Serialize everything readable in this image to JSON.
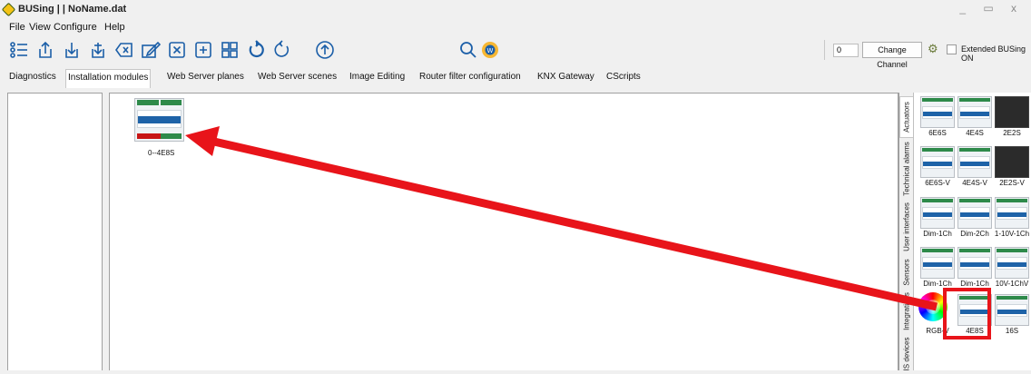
{
  "window": {
    "title": "BUSing | | NoName.dat",
    "controls": "_ ▭ x"
  },
  "menu": [
    "File",
    "View",
    "Configure",
    "Help"
  ],
  "toolbar": {
    "icons": [
      "list-icon",
      "upload-icon",
      "download-icon",
      "download-all-icon",
      "clear-icon",
      "edit-icon",
      "close-box-icon",
      "add-box-icon",
      "layout-icon",
      "undo-icon",
      "redo-icon",
      "up-circle-icon",
      "search-icon",
      "web-icon"
    ],
    "channel_value": "0",
    "change_channel_label": "Change Channel",
    "extended_label": "Extended BUSing ON"
  },
  "tabs": [
    "Diagnostics",
    "Installation modules",
    "Web Server planes",
    "Web Server scenes",
    "Image Editing",
    "Router filter configuration",
    "KNX Gateway",
    "CScripts"
  ],
  "active_tab": "Installation modules",
  "canvas": {
    "module_label": "0--4E8S"
  },
  "side_tabs": [
    "Actuators",
    "Technical alarms",
    "User interfaces",
    "Sensors",
    "Integrations",
    "IS devices"
  ],
  "palette": {
    "items": [
      "6E6S",
      "4E4S",
      "2E2S",
      "6E6S-V",
      "4E4S-V",
      "2E2S-V",
      "Dim-1Ch",
      "Dim-2Ch",
      "1-10V-1Ch",
      "Dim-1Ch",
      "Dim-1Ch",
      "10V-1ChV",
      "RGB-V",
      "4E8S",
      "16S"
    ]
  },
  "colors": {
    "highlight": "#e8141a",
    "arrow": "#e8141a",
    "module_green": "#2e8a4a",
    "module_blue": "#1e63a8"
  }
}
